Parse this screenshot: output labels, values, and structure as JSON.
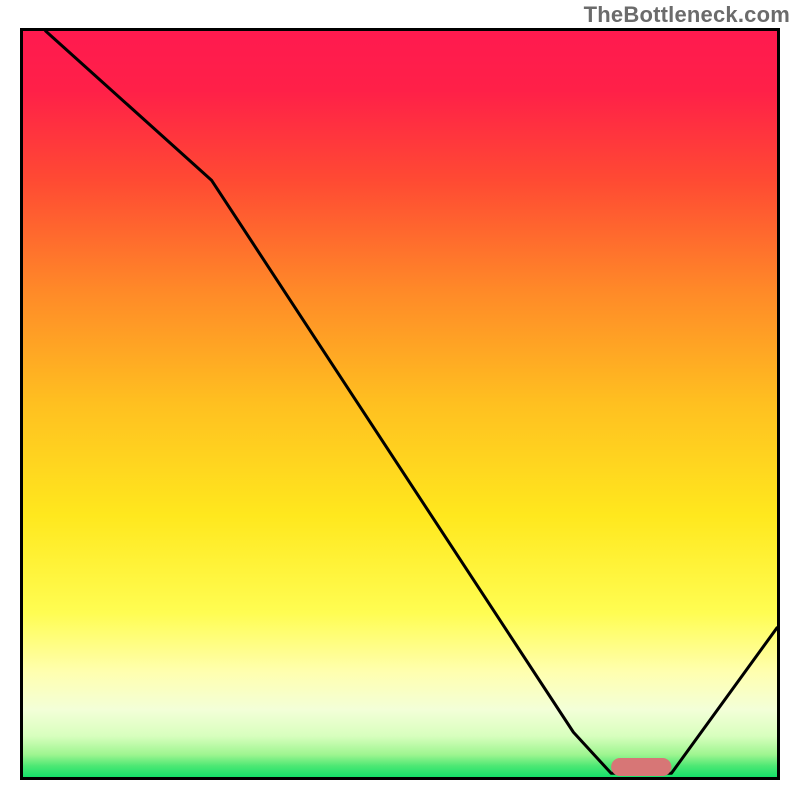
{
  "watermark": "TheBottleneck.com",
  "gradient_stops": [
    {
      "offset": 0,
      "color": "#ff1a4f"
    },
    {
      "offset": 0.08,
      "color": "#ff2048"
    },
    {
      "offset": 0.2,
      "color": "#ff4a33"
    },
    {
      "offset": 0.35,
      "color": "#ff8a28"
    },
    {
      "offset": 0.5,
      "color": "#ffc020"
    },
    {
      "offset": 0.65,
      "color": "#ffe81e"
    },
    {
      "offset": 0.78,
      "color": "#fffd52"
    },
    {
      "offset": 0.86,
      "color": "#ffffb0"
    },
    {
      "offset": 0.91,
      "color": "#f3ffd8"
    },
    {
      "offset": 0.945,
      "color": "#d8ffbe"
    },
    {
      "offset": 0.97,
      "color": "#9ef590"
    },
    {
      "offset": 0.985,
      "color": "#4ee874"
    },
    {
      "offset": 1.0,
      "color": "#15e06a"
    }
  ],
  "marker": {
    "color": "#d77676",
    "radius": 9
  },
  "chart_data": {
    "type": "line",
    "title": "",
    "xlabel": "",
    "ylabel": "",
    "xlim": [
      0,
      100
    ],
    "ylim": [
      0,
      100
    ],
    "marker_segment_x": [
      78,
      86
    ],
    "series": [
      {
        "name": "curve",
        "x": [
          3,
          25,
          73,
          78,
          86,
          100
        ],
        "y": [
          100,
          80,
          6,
          0.5,
          0.5,
          20
        ]
      }
    ],
    "note": "y represents height above baseline as percent of plot height; curve starts at top-left, bends near x≈25, falls steeply to a flat minimum over x≈78–86 (marker region), then rises toward right edge."
  }
}
